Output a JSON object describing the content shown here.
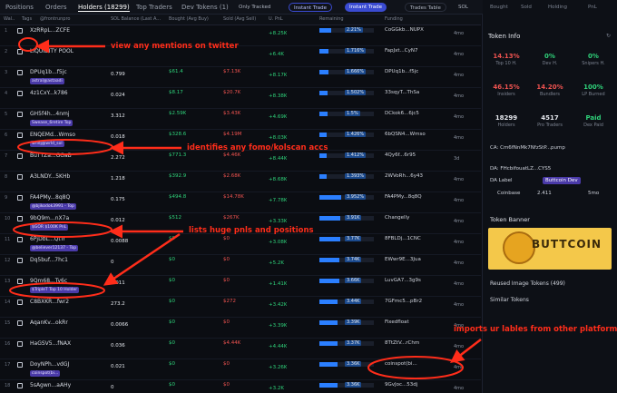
{
  "tabs": [
    "Positions",
    "Orders",
    "Holders (18299)",
    "Top Traders",
    "Dev Tokens (1)"
  ],
  "toolbar": {
    "only_tracked": "Only Tracked",
    "instant_trade_1": "Instant Trade",
    "instant_trade_2": "Instant Trade",
    "trades_table": "Trades Table",
    "sol": "SOL"
  },
  "columns": [
    "Wal..",
    "Tags",
    "@frontrunpro",
    "SOL Balance (Last A...",
    "Bought (Avg Buy)",
    "Sold (Avg Sell)",
    "U. PnL",
    "Remaining",
    "Funding"
  ],
  "right_header": {
    "bought": "Bought",
    "sold": "Sold",
    "holding": "Holding",
    "pnl": "PnL"
  },
  "token_info": {
    "title": "Token Info",
    "stats": [
      {
        "value": "14.13%",
        "label": "Top 10 H.",
        "color": "#ef5350"
      },
      {
        "value": "0%",
        "label": "Dev H.",
        "color": "#2fd27a"
      },
      {
        "value": "0%",
        "label": "Snipers H.",
        "color": "#2fd27a"
      },
      {
        "value": "46.15%",
        "label": "Insiders",
        "color": "#ef5350"
      },
      {
        "value": "14.20%",
        "label": "Bundlers",
        "color": "#ef5350"
      },
      {
        "value": "100%",
        "label": "LP Burned",
        "color": "#2fd27a"
      },
      {
        "value": "18299",
        "label": "Holders",
        "color": "#e3e6ec"
      },
      {
        "value": "4517",
        "label": "Pro Traders",
        "color": "#e3e6ec"
      },
      {
        "value": "Paid",
        "label": "Dex Paid",
        "color": "#2fd27a"
      }
    ],
    "ca": "CA: Cm6fNnMk7NfzStP...pump",
    "da": "DA: FHcbifouatLZ...CYS5",
    "da_label": "DA Label",
    "da_badge": "Buttcoin Dev",
    "coinbase": "Coinbase",
    "coinbase_val": "2.411",
    "coinbase_age": "5mo"
  },
  "banner": {
    "title": "Token Banner",
    "text": "BUTTCOIN"
  },
  "reused": "Reused Image Tokens (499)",
  "similar": "Similar Tokens",
  "rows": [
    {
      "idx": "1",
      "addr": "XzRRpL...ZCFE",
      "tags": [],
      "sol": "",
      "bought": "",
      "sold": "",
      "upnl": "+8.25K",
      "remaining": "2.21%",
      "rem": 0.22,
      "funding": "CoGGkb...NUPX",
      "age": "4mo"
    },
    {
      "idx": "2",
      "addr": "LIQUIDITY POOL",
      "tags": [],
      "sol": "",
      "bought": "",
      "sold": "",
      "upnl": "+6.4K",
      "remaining": "1.716%",
      "rem": 0.17,
      "funding": "FapJxt...CyN7",
      "age": "4mo"
    },
    {
      "idx": "3",
      "addr": "DPUq1b...f5jc",
      "tags": [
        "astral@astaadi"
      ],
      "sol": "0.799",
      "bought": "$61.4",
      "sold": "$7.13K",
      "upnl": "+8.17K",
      "remaining": "1.666%",
      "rem": 0.17,
      "funding": "DPUq1b...f5jc",
      "age": "4mo"
    },
    {
      "idx": "4",
      "addr": "4z1CxY...k786",
      "tags": [],
      "sol": "0.024",
      "bought": "$8.17",
      "sold": "$20.7K",
      "upnl": "+8.38K",
      "remaining": "1.502%",
      "rem": 0.15,
      "funding": "33sqyT...ThSa",
      "age": "4mo"
    },
    {
      "idx": "5",
      "addr": "GH5f4h...4nmj",
      "tags": [
        "Swease_6retire Top"
      ],
      "sol": "3.312",
      "bought": "$2.59K",
      "sold": "$3.43K",
      "upnl": "+4.69K",
      "remaining": "1.5%",
      "rem": 0.15,
      "funding": "DCkok6...6jc5",
      "age": "4mo"
    },
    {
      "idx": "6",
      "addr": "ENQEMd...Wmso",
      "tags": [
        "wridj@wrld_sol"
      ],
      "sol": "0.018",
      "bought": "$328.6",
      "sold": "$4.19M",
      "upnl": "+8.03K",
      "remaining": "1.426%",
      "rem": 0.14,
      "funding": "6bQSN4...Wmso",
      "age": "4mo"
    },
    {
      "idx": "7",
      "addr": "BuTTZa...GGaB",
      "tags": [],
      "sol": "2.272",
      "bought": "$771.3",
      "sold": "$4.46K",
      "upnl": "+8.44K",
      "remaining": "1.412%",
      "rem": 0.14,
      "funding": "4Qy6f...6r95",
      "age": "3d"
    },
    {
      "idx": "8",
      "addr": "A3LNDY...5KHb",
      "tags": [],
      "sol": "1.218",
      "bought": "$392.9",
      "sold": "$2.68K",
      "upnl": "+8.68K",
      "remaining": "1.393%",
      "rem": 0.14,
      "funding": "2WVoRh...6y43",
      "age": "4mo"
    },
    {
      "idx": "9",
      "addr": "FA4PMy...8q8Q",
      "tags": [
        "@bjikodok3991 - Top"
      ],
      "sol": "0.175",
      "bought": "$494.8",
      "sold": "$14.78K",
      "upnl": "+7.78K",
      "remaining": "3.952%",
      "rem": 0.4,
      "funding": "FA4PMy...8q8Q",
      "age": "4mo"
    },
    {
      "idx": "10",
      "addr": "9bQ9m...nX7a",
      "tags": [
        "$GOR $100K PnL"
      ],
      "sol": "0.012",
      "bound": "",
      "bought": "$512",
      "sold": "$267K",
      "upnl": "+3.33K",
      "remaining": "3.91K",
      "rem": 0.39,
      "funding": "Changelly",
      "age": "4mo"
    },
    {
      "idx": "11",
      "addr": "6PjDbL...QtTr",
      "tags": [
        "@believer12137 - Top"
      ],
      "sol": "0.0088",
      "bought": "$0",
      "sold": "$0",
      "upnl": "+3.08K",
      "remaining": "3.77K",
      "rem": 0.38,
      "funding": "8FBLDj...1CNC",
      "age": "4mo"
    },
    {
      "idx": "12",
      "addr": "Dq5buf...7hc1",
      "tags": [],
      "sol": "0",
      "bought": "$0",
      "sold": "$0",
      "upnl": "+5.2K",
      "remaining": "3.74K",
      "rem": 0.37,
      "funding": "EWwr9E...3Jua",
      "age": "4mo"
    },
    {
      "idx": "13",
      "addr": "9Qm68...Ty6c",
      "tags": [
        "$TripleT Top 10 Holder"
      ],
      "sol": "0.011",
      "bought": "$0",
      "sold": "$0",
      "upnl": "+1.41K",
      "remaining": "3.66K",
      "rem": 0.37,
      "funding": "LuvGA7...3g9s",
      "age": "4mo"
    },
    {
      "idx": "14",
      "addr": "C8BXKR...fwr2",
      "tags": [],
      "sol": "273.2",
      "bought": "$0",
      "sold": "$272",
      "upnl": "+3.42K",
      "remaining": "3.44K",
      "rem": 0.34,
      "funding": "7GFmc5...pBr2",
      "age": "4mo"
    },
    {
      "idx": "15",
      "addr": "AqanKv...okRr",
      "tags": [],
      "sol": "0.0066",
      "bought": "$0",
      "sold": "$0",
      "upnl": "+3.39K",
      "remaining": "3.39K",
      "rem": 0.34,
      "funding": "Fixedfloat",
      "age": "4mo"
    },
    {
      "idx": "16",
      "addr": "HaGSV5...fNAX",
      "tags": [],
      "sol": "0.036",
      "bought": "$0",
      "sold": "$4.44K",
      "upnl": "+4.44K",
      "remaining": "3.37K",
      "rem": 0.34,
      "funding": "8TtZtV...rChm",
      "age": "4mo"
    },
    {
      "idx": "17",
      "addr": "DoyNPh...vdGJ",
      "tags": [
        "coinspot(bi..."
      ],
      "sol": "0.021",
      "bought": "$0",
      "sold": "$0",
      "upnl": "+3.26K",
      "remaining": "3.36K",
      "rem": 0.34,
      "funding": "coinspot(bi...",
      "age": "4mo"
    },
    {
      "idx": "18",
      "addr": "5sAgwn...aAHy",
      "tags": [],
      "sol": "0",
      "bought": "$0",
      "sold": "$0",
      "upnl": "+3.2K",
      "remaining": "3.36K",
      "rem": 0.34,
      "funding": "9GvJoc...53dj",
      "age": "4mo"
    }
  ],
  "annotations": [
    "view any mentions on twitter",
    "identifies any fomo/kolscan accs",
    "lists huge pnls and positions",
    "imports ur lables from other platforms"
  ]
}
